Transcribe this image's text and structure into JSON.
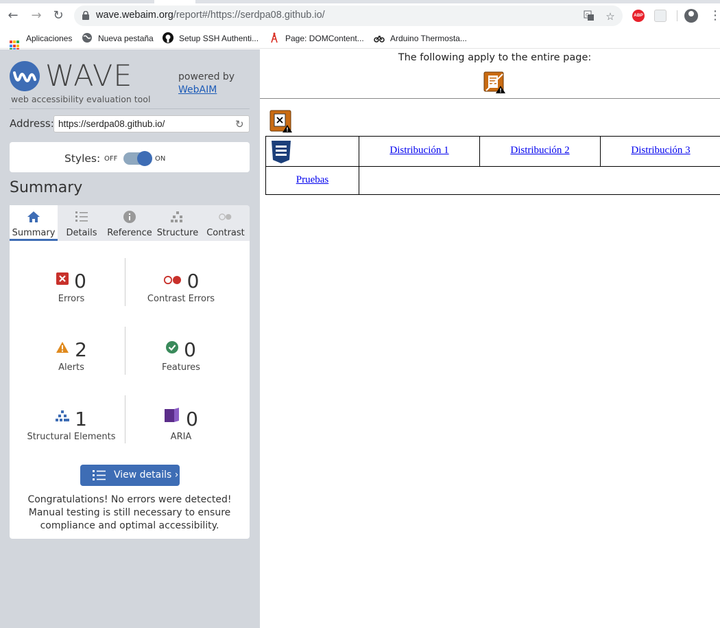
{
  "browser": {
    "url_host": "wave.webaim.org",
    "url_path": "/report#/https://serdpa08.github.io/",
    "bookmarks": [
      {
        "label": "Aplicaciones",
        "icon": "apps-grid-icon"
      },
      {
        "label": "Nueva pestaña",
        "icon": "globe-icon"
      },
      {
        "label": "Setup SSH Authenti...",
        "icon": "github-icon"
      },
      {
        "label": "Page: DOMContent...",
        "icon": "tower-icon"
      },
      {
        "label": "Arduino Thermosta...",
        "icon": "motorbike-icon"
      }
    ],
    "extension_abp_label": "ABP"
  },
  "wave": {
    "logo_text": "WAVE",
    "logo_subtitle": "web accessibility evaluation tool",
    "powered_by": "powered by",
    "powered_link": "WebAIM",
    "address_label": "Address:",
    "address_value": "https://serdpa08.github.io/",
    "styles_label": "Styles:",
    "styles_off": "OFF",
    "styles_on": "ON",
    "styles_state": "on",
    "summary_heading": "Summary",
    "tabs": [
      {
        "label": "Summary",
        "icon": "home-icon",
        "active": true
      },
      {
        "label": "Details",
        "icon": "list-icon",
        "active": false
      },
      {
        "label": "Reference",
        "icon": "info-icon",
        "active": false
      },
      {
        "label": "Structure",
        "icon": "hierarchy-icon",
        "active": false
      },
      {
        "label": "Contrast",
        "icon": "contrast-icon",
        "active": false
      }
    ],
    "stats": {
      "errors": {
        "count": "0",
        "label": "Errors"
      },
      "contrast_errors": {
        "count": "0",
        "label": "Contrast Errors"
      },
      "alerts": {
        "count": "2",
        "label": "Alerts"
      },
      "features": {
        "count": "0",
        "label": "Features"
      },
      "structural": {
        "count": "1",
        "label": "Structural Elements"
      },
      "aria": {
        "count": "0",
        "label": "ARIA"
      }
    },
    "view_details": "View details ›",
    "congrats": "Congratulations! No errors were detected! Manual testing is still necessary to ensure compliance and optimal accessibility."
  },
  "page": {
    "apply_text": "The following apply to the entire page:",
    "nav_links": [
      "Distribución 1",
      "Distribución 2",
      "Distribución 3",
      "Pruebas"
    ]
  },
  "colors": {
    "wave_blue": "#3e6db5",
    "error_red": "#c8312b",
    "alert_orange": "#e08a1e",
    "feature_green": "#3a8a5b",
    "aria_purple": "#5b2d8a",
    "sidebar_bg": "#d2d6dc"
  }
}
